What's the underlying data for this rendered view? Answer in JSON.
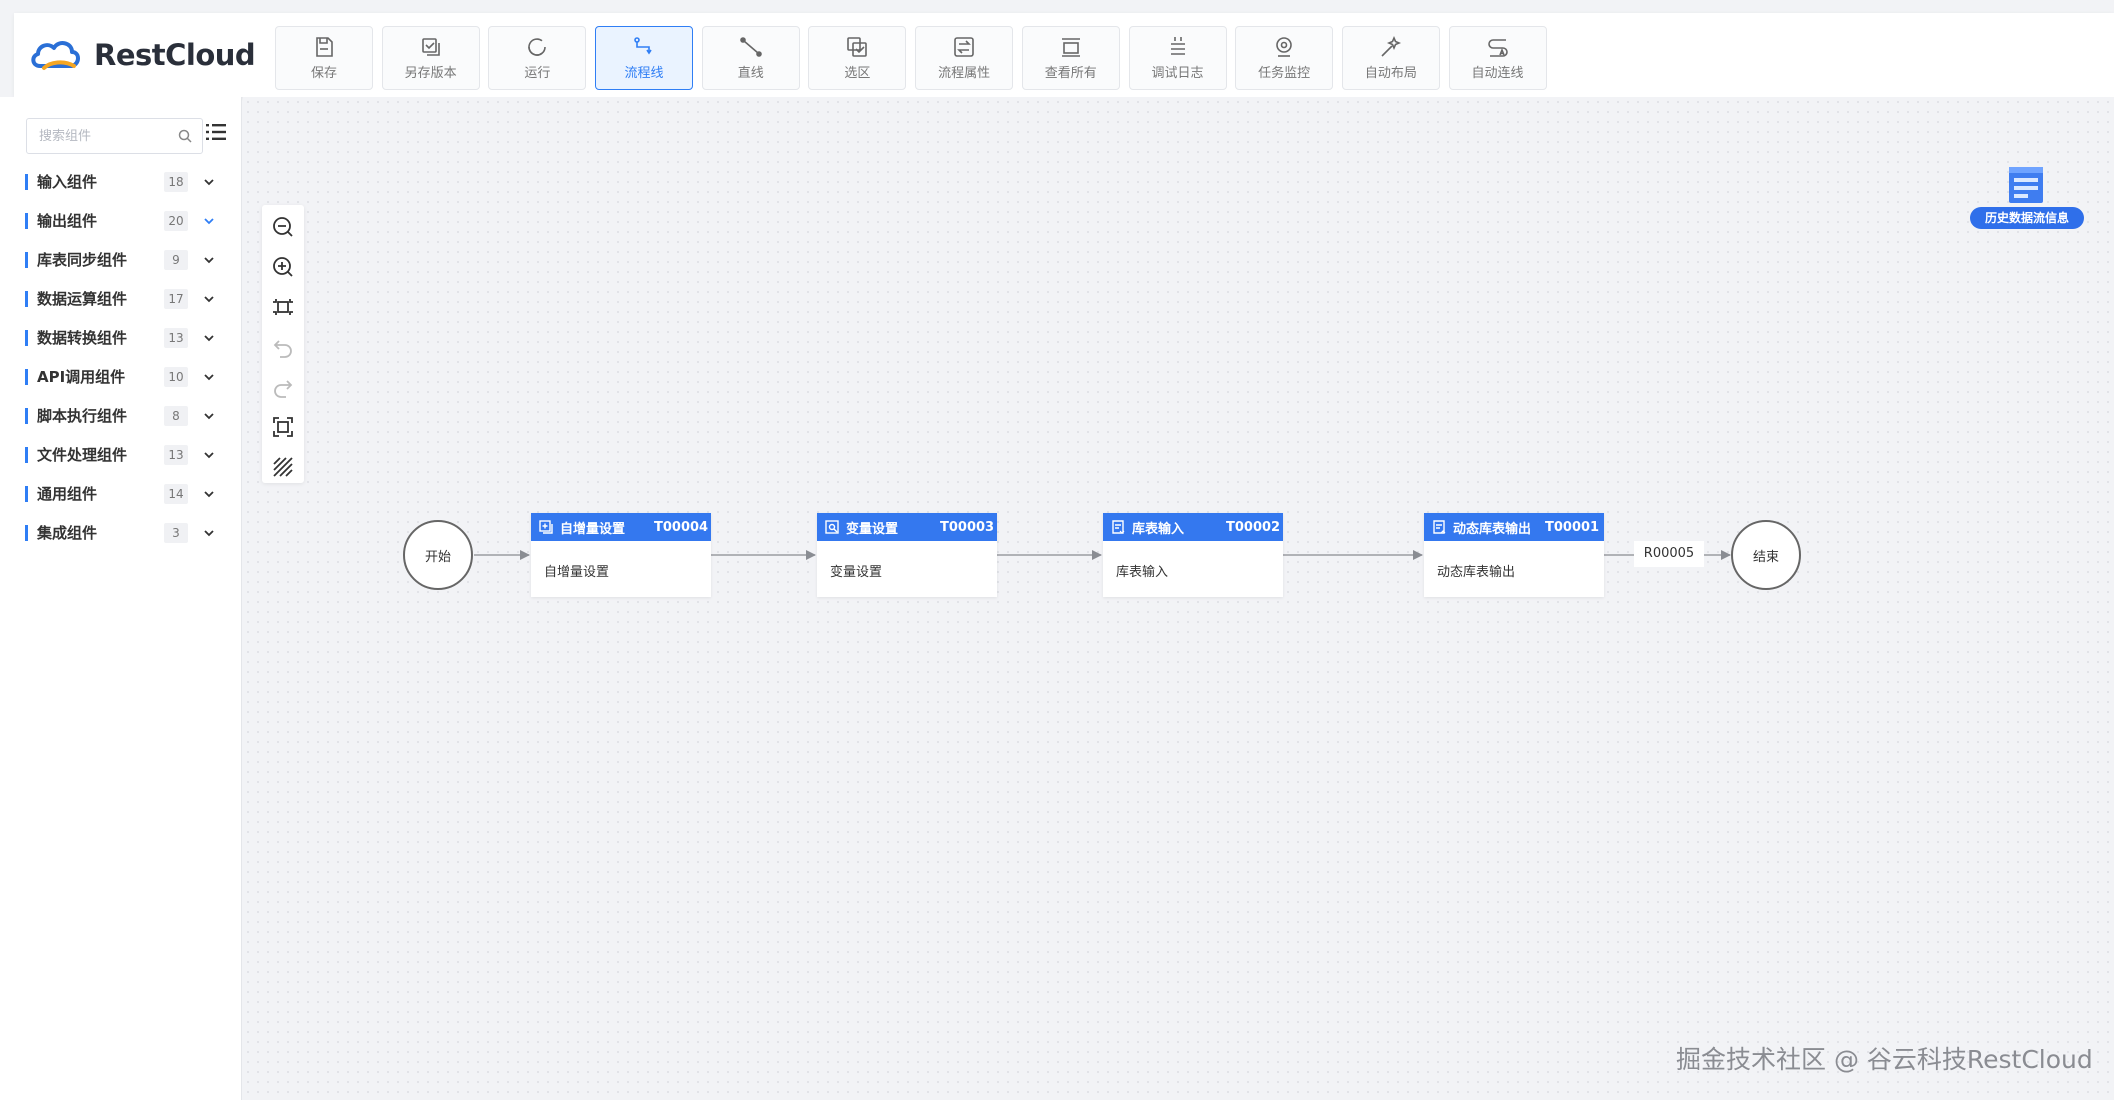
{
  "app": {
    "logo_text": "RestCloud"
  },
  "toolbar": [
    {
      "label": "保存",
      "icon": "save-icon"
    },
    {
      "label": "另存版本",
      "icon": "save-version-icon"
    },
    {
      "label": "运行",
      "icon": "run-icon"
    },
    {
      "label": "流程线",
      "icon": "flow-line-icon",
      "active": true
    },
    {
      "label": "直线",
      "icon": "straight-line-icon"
    },
    {
      "label": "选区",
      "icon": "select-area-icon"
    },
    {
      "label": "流程属性",
      "icon": "flow-properties-icon"
    },
    {
      "label": "查看所有",
      "icon": "view-all-icon"
    },
    {
      "label": "调试日志",
      "icon": "debug-log-icon"
    },
    {
      "label": "任务监控",
      "icon": "task-monitor-icon"
    },
    {
      "label": "自动布局",
      "icon": "auto-layout-icon"
    },
    {
      "label": "自动连线",
      "icon": "auto-connect-icon"
    }
  ],
  "sidebar": {
    "search_placeholder": "搜索组件",
    "categories": [
      {
        "name": "输入组件",
        "count": "18"
      },
      {
        "name": "输出组件",
        "count": "20"
      },
      {
        "name": "库表同步组件",
        "count": "9"
      },
      {
        "name": "数据运算组件",
        "count": "17"
      },
      {
        "name": "数据转换组件",
        "count": "13"
      },
      {
        "name": "API调用组件",
        "count": "10"
      },
      {
        "name": "脚本执行组件",
        "count": "8"
      },
      {
        "name": "文件处理组件",
        "count": "13"
      },
      {
        "name": "通用组件",
        "count": "14"
      },
      {
        "name": "集成组件",
        "count": "3"
      }
    ]
  },
  "flow": {
    "start_label": "开始",
    "end_label": "结束",
    "nodes": [
      {
        "title": "自增量设置",
        "id": "T00004",
        "body": "自增量设置"
      },
      {
        "title": "变量设置",
        "id": "T00003",
        "body": "变量设置"
      },
      {
        "title": "库表输入",
        "id": "T00002",
        "body": "库表输入"
      },
      {
        "title": "动态库表输出",
        "id": "T00001",
        "body": "动态库表输出"
      }
    ],
    "edge_label": "R00005"
  },
  "history": {
    "label": "历史数据流信息"
  },
  "watermark": "掘金技术社区 @ 谷云科技RestCloud",
  "colors": {
    "accent": "#2f7ef5",
    "node_header": "#3478ef"
  }
}
